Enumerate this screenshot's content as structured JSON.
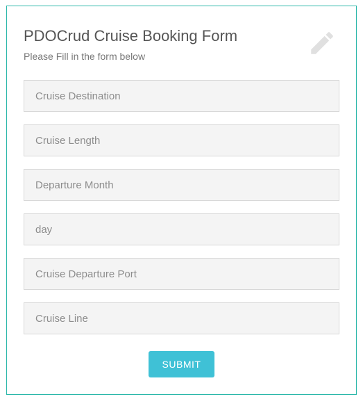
{
  "header": {
    "title": "PDOCrud Cruise Booking Form",
    "subtitle": "Please Fill in the form below"
  },
  "fields": {
    "destination_ph": "Cruise Destination",
    "length_ph": "Cruise Length",
    "month_ph": "Departure Month",
    "day_ph": "day",
    "port_ph": "Cruise Departure Port",
    "line_ph": "Cruise Line"
  },
  "submit_label": "SUBMIT"
}
